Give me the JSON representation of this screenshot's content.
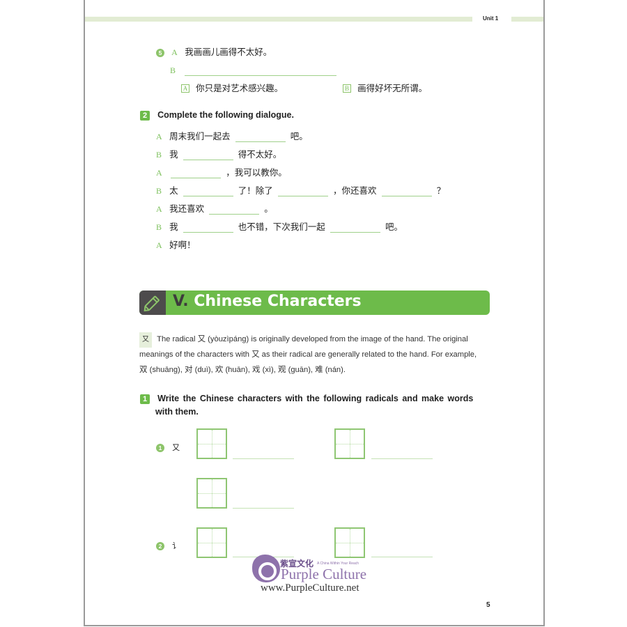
{
  "header": {
    "unit": "Unit 1"
  },
  "exercise5": {
    "number": "5",
    "line_a": {
      "speaker": "A",
      "text": "我画画儿画得不太好。"
    },
    "line_b": {
      "speaker": "B"
    },
    "options": [
      {
        "key": "A",
        "text": "你只是对艺术感兴趣。"
      },
      {
        "key": "B",
        "text": "画得好坏无所谓。"
      }
    ]
  },
  "exercise2": {
    "number": "2",
    "instruction": "Complete the following dialogue.",
    "lines": [
      {
        "speaker": "A",
        "parts": [
          "周末我们一起去",
          "吧。"
        ]
      },
      {
        "speaker": "B",
        "parts": [
          "我",
          "得不太好。"
        ]
      },
      {
        "speaker": "A",
        "parts": [
          "",
          "，我可以教你。"
        ]
      },
      {
        "speaker": "B",
        "parts": [
          "太",
          "了！除了",
          "，你还喜欢",
          "？"
        ]
      },
      {
        "speaker": "A",
        "parts": [
          "我还喜欢",
          "。"
        ]
      },
      {
        "speaker": "B",
        "parts": [
          "我",
          "也不错，下次我们一起",
          "吧。"
        ]
      },
      {
        "speaker": "A",
        "parts": [
          "好啊！"
        ]
      }
    ]
  },
  "section": {
    "icon": "pencil-icon",
    "roman": "V.",
    "title": "Chinese Characters"
  },
  "radical_note": {
    "chip": "⺀又",
    "line1_a": "The radical",
    "radical": "又",
    "line1_b": "(yòuzìpáng) is originally developed from the image of the hand. The original",
    "line2_a": "meanings of the characters with",
    "line2_b": "as their radical are generally related to the hand. For example,",
    "examples": [
      {
        "char": "双",
        "pinyin": "(shuāng),"
      },
      {
        "char": "对",
        "pinyin": "(duì),"
      },
      {
        "char": "欢",
        "pinyin": "(huān),"
      },
      {
        "char": "戏",
        "pinyin": "(xì),"
      },
      {
        "char": "观",
        "pinyin": "(guān),"
      },
      {
        "char": "难",
        "pinyin": "(nán)."
      }
    ]
  },
  "exercise1": {
    "number": "1",
    "instruction_line1": "Write the Chinese characters with the following radicals and make words",
    "instruction_line2": "with them.",
    "items": [
      {
        "number": "1",
        "radical": "又"
      },
      {
        "number": "2",
        "radical": "讠"
      }
    ]
  },
  "watermark": {
    "cn": "紫宣文化",
    "tagline": "A China Within Your Reach",
    "name": "Purple Culture",
    "url": "www.PurpleCulture.net"
  },
  "page_number": "5"
}
